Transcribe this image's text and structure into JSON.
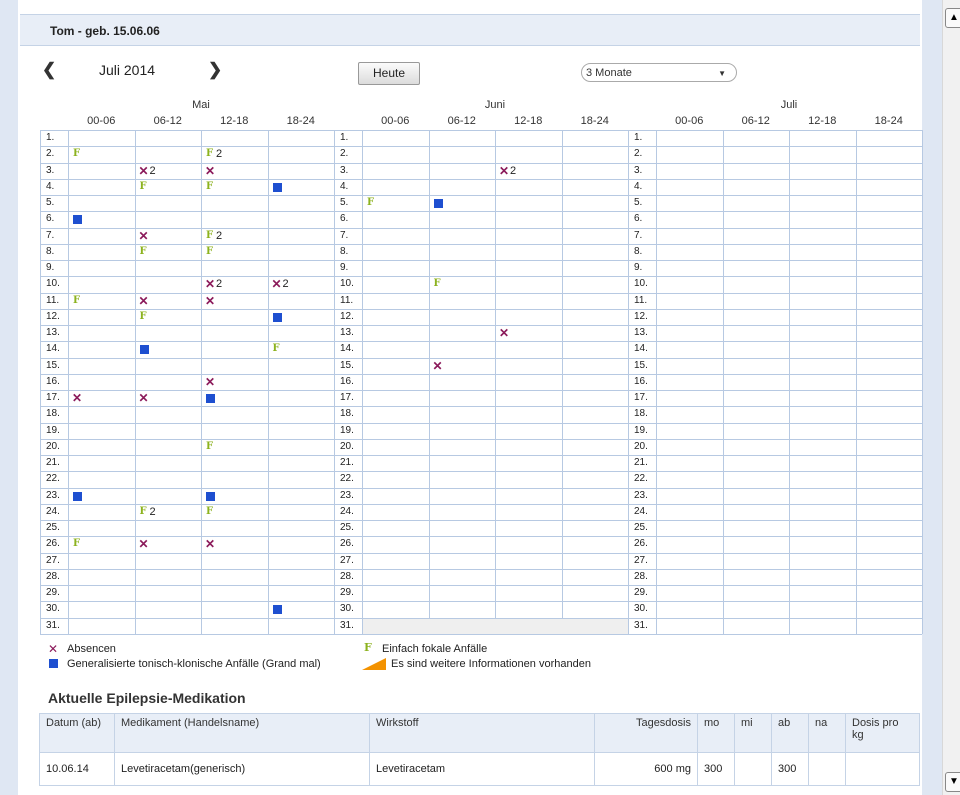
{
  "patient": "Tom - geb. 15.06.06",
  "nav": {
    "prev": "❮",
    "next": "❯",
    "month_title": "Juli 2014",
    "today": "Heute",
    "range": "3 Monate"
  },
  "months": [
    {
      "name": "Mai",
      "days": 31,
      "entries": [
        {
          "day": 2,
          "slot": 0,
          "t": "F"
        },
        {
          "day": 2,
          "slot": 2,
          "t": "F",
          "n": "2"
        },
        {
          "day": 3,
          "slot": 1,
          "t": "X",
          "n": "2"
        },
        {
          "day": 3,
          "slot": 2,
          "t": "X"
        },
        {
          "day": 4,
          "slot": 1,
          "t": "F"
        },
        {
          "day": 4,
          "slot": 2,
          "t": "F"
        },
        {
          "day": 4,
          "slot": 3,
          "t": "G"
        },
        {
          "day": 6,
          "slot": 0,
          "t": "G"
        },
        {
          "day": 7,
          "slot": 1,
          "t": "X"
        },
        {
          "day": 7,
          "slot": 2,
          "t": "F",
          "n": "2"
        },
        {
          "day": 8,
          "slot": 1,
          "t": "F"
        },
        {
          "day": 8,
          "slot": 2,
          "t": "F"
        },
        {
          "day": 10,
          "slot": 2,
          "t": "X",
          "n": "2"
        },
        {
          "day": 10,
          "slot": 3,
          "t": "X",
          "n": "2"
        },
        {
          "day": 11,
          "slot": 0,
          "t": "F"
        },
        {
          "day": 11,
          "slot": 1,
          "t": "X"
        },
        {
          "day": 11,
          "slot": 2,
          "t": "X"
        },
        {
          "day": 12,
          "slot": 1,
          "t": "F"
        },
        {
          "day": 12,
          "slot": 3,
          "t": "G"
        },
        {
          "day": 14,
          "slot": 1,
          "t": "G"
        },
        {
          "day": 14,
          "slot": 3,
          "t": "F"
        },
        {
          "day": 16,
          "slot": 2,
          "t": "X"
        },
        {
          "day": 17,
          "slot": 0,
          "t": "X"
        },
        {
          "day": 17,
          "slot": 1,
          "t": "X"
        },
        {
          "day": 17,
          "slot": 2,
          "t": "G"
        },
        {
          "day": 20,
          "slot": 2,
          "t": "F"
        },
        {
          "day": 23,
          "slot": 0,
          "t": "G"
        },
        {
          "day": 23,
          "slot": 2,
          "t": "G"
        },
        {
          "day": 24,
          "slot": 1,
          "t": "F",
          "n": "2"
        },
        {
          "day": 24,
          "slot": 2,
          "t": "F"
        },
        {
          "day": 26,
          "slot": 0,
          "t": "F"
        },
        {
          "day": 26,
          "slot": 1,
          "t": "X"
        },
        {
          "day": 26,
          "slot": 2,
          "t": "X"
        },
        {
          "day": 30,
          "slot": 3,
          "t": "G"
        }
      ]
    },
    {
      "name": "Juni",
      "days": 30,
      "entries": [
        {
          "day": 3,
          "slot": 2,
          "t": "X",
          "n": "2"
        },
        {
          "day": 5,
          "slot": 0,
          "t": "F"
        },
        {
          "day": 5,
          "slot": 1,
          "t": "G"
        },
        {
          "day": 10,
          "slot": 1,
          "t": "F"
        },
        {
          "day": 13,
          "slot": 2,
          "t": "X"
        },
        {
          "day": 15,
          "slot": 1,
          "t": "X"
        }
      ]
    },
    {
      "name": "Juli",
      "days": 31,
      "entries": []
    }
  ],
  "slots": [
    "00-06",
    "06-12",
    "12-18",
    "18-24"
  ],
  "legend": {
    "absence": "Absencen",
    "focal": "Einfach fokale Anfälle",
    "grand_mal": "Generalisierte tonisch-klonische Anfälle (Grand mal)",
    "more_info": "Es sind weitere Informationen vorhanden"
  },
  "colors": {
    "absence": "#8b1a5a",
    "focal": "#8cb21e",
    "grand_mal": "#1e4fd0",
    "info": "#f39200",
    "grid": "#b7c9e2"
  },
  "medication": {
    "title": "Aktuelle Epilepsie-Medikation",
    "headers": [
      "Datum (ab)",
      "Medikament (Handelsname)",
      "Wirkstoff",
      "Tagesdosis",
      "mo",
      "mi",
      "ab",
      "na",
      "Dosis pro kg"
    ],
    "rows": [
      [
        "10.06.14",
        "Levetiracetam(generisch)",
        "Levetiracetam",
        "600 mg",
        "300",
        "",
        "300",
        "",
        ""
      ]
    ]
  }
}
